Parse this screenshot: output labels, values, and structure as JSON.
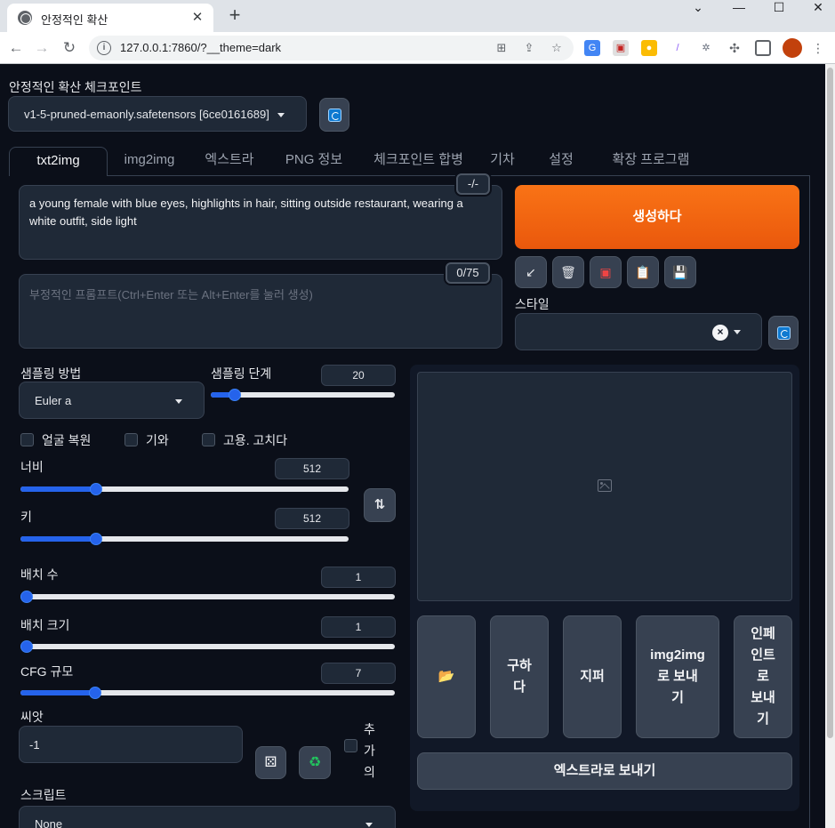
{
  "browser": {
    "tab_title": "안정적인 확산",
    "url": "127.0.0.1:7860/?__theme=dark",
    "window_controls": [
      "minimize",
      "maximize",
      "close"
    ]
  },
  "checkpoint": {
    "label": "안정적인 확산 체크포인트",
    "value": "v1-5-pruned-emaonly.safetensors [6ce0161689]"
  },
  "tabs": [
    "txt2img",
    "img2img",
    "엑스트라",
    "PNG 정보",
    "체크포인트 합병",
    "기차",
    "설정",
    "확장 프로그램"
  ],
  "prompt": {
    "value": "a young female with blue eyes, highlights in hair, sitting outside restaurant, wearing a white outfit, side light",
    "toggle_label": "-/-",
    "token_count": "0/75"
  },
  "negative_prompt": {
    "placeholder": "부정적인 프롬프트(Ctrl+Enter 또는 Alt+Enter를 눌러 생성)"
  },
  "generate": {
    "label": "생성하다"
  },
  "tool_buttons": [
    "arrow-icon",
    "trash-icon",
    "red-card-icon",
    "clipboard-icon",
    "save-icon"
  ],
  "styles": {
    "label": "스타일",
    "value": ""
  },
  "sampling": {
    "method_label": "샘플링 방법",
    "method_value": "Euler a",
    "steps_label": "샘플링 단계",
    "steps_value": "20",
    "steps_fraction": 0.13
  },
  "options": {
    "restore_faces": "얼굴 복원",
    "tiling": "기와",
    "hires_fix": "고용. 고치다"
  },
  "width": {
    "label": "너비",
    "value": "512",
    "fraction": 0.23
  },
  "height": {
    "label": "키",
    "value": "512",
    "fraction": 0.23
  },
  "batch_count": {
    "label": "배치 수",
    "value": "1",
    "fraction": 0
  },
  "batch_size": {
    "label": "배치 크기",
    "value": "1",
    "fraction": 0
  },
  "cfg_scale": {
    "label": "CFG 규모",
    "value": "7",
    "fraction": 0.2
  },
  "seed": {
    "label": "씨앗",
    "value": "-1",
    "extra_label": "추\n가\n의"
  },
  "script": {
    "label": "스크립트",
    "value": "None"
  },
  "output_actions": {
    "folder": "📂",
    "save": "구하\n다",
    "zip": "지퍼",
    "send_img2img": "img2img\n로 보내\n기",
    "send_inpaint": "인페\n인트\n로\n보내\n기",
    "send_extras": "엑스트라로 보내기"
  },
  "colors": {
    "background": "#0b0f19",
    "panel": "#1f2937",
    "accent": "#ea580c",
    "slider": "#2563eb"
  }
}
